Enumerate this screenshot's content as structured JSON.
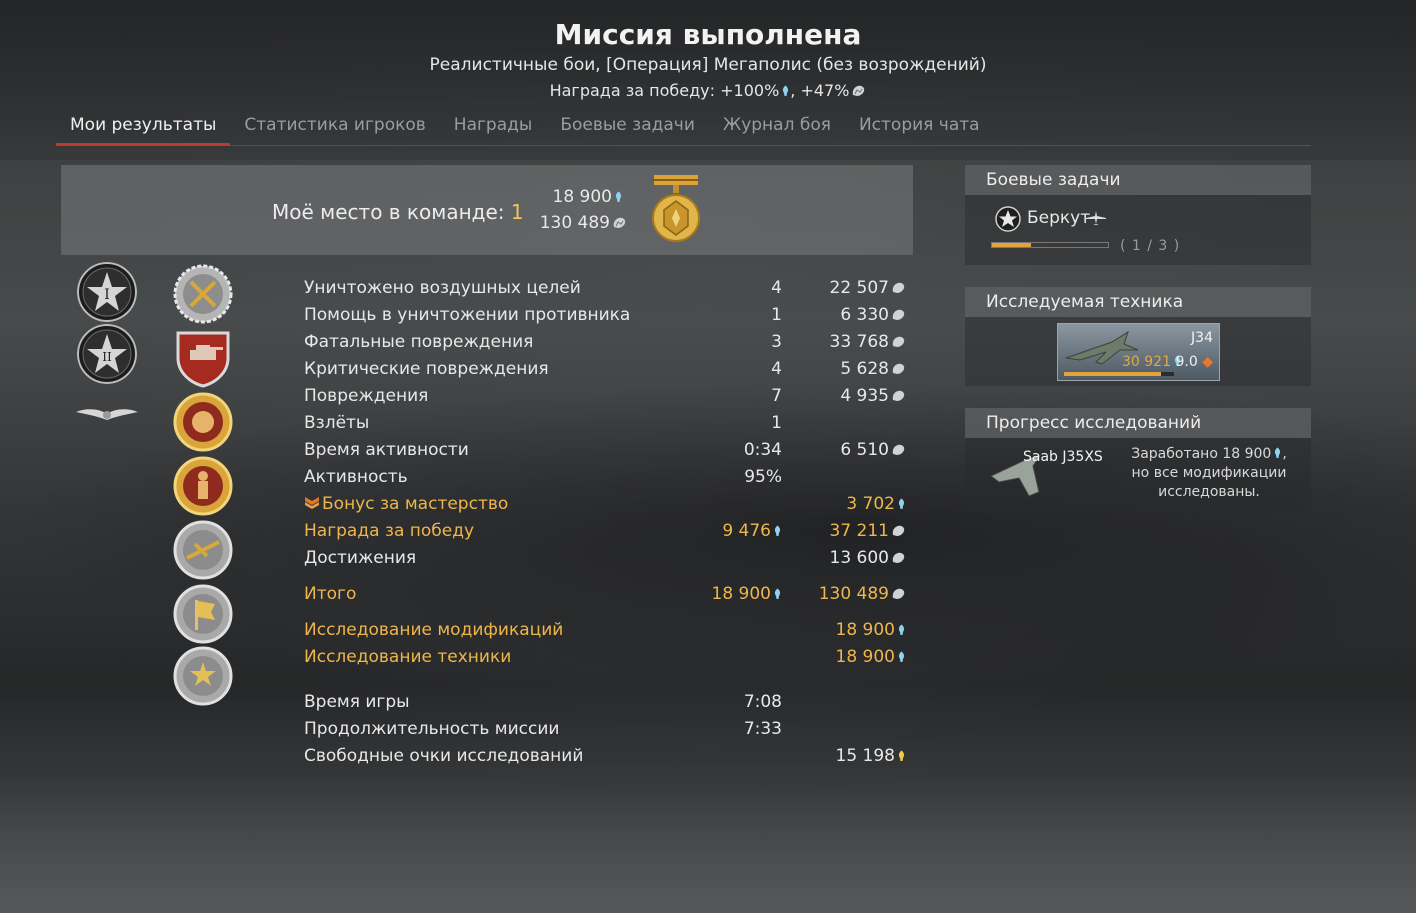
{
  "header": {
    "title": "Миссия выполнена",
    "subtitle": "Реалистичные бои, [Операция] Мегаполис (без возрождений)",
    "reward_prefix": "Награда за победу: +100%",
    "reward_sep": ", +47%"
  },
  "tabs": [
    {
      "label": "Мои результаты",
      "active": true
    },
    {
      "label": "Статистика игроков"
    },
    {
      "label": "Награды"
    },
    {
      "label": "Боевые задачи"
    },
    {
      "label": "Журнал боя"
    },
    {
      "label": "История чата"
    }
  ],
  "team_place": {
    "label": "Моё место в команде:",
    "place": "1",
    "rp": "18 900",
    "sl": "130 489"
  },
  "stats": [
    {
      "label": "Уничтожено воздушных целей",
      "count": "4",
      "value": "22 507",
      "icon": "sl"
    },
    {
      "label": "Помощь в уничтожении противника",
      "count": "1",
      "value": "6 330",
      "icon": "sl"
    },
    {
      "label": "Фатальные повреждения",
      "count": "3",
      "value": "33 768",
      "icon": "sl"
    },
    {
      "label": "Критические повреждения",
      "count": "4",
      "value": "5 628",
      "icon": "sl"
    },
    {
      "label": "Повреждения",
      "count": "7",
      "value": "4 935",
      "icon": "sl"
    },
    {
      "label": "Взлёты",
      "count": "1",
      "value": "",
      "icon": ""
    },
    {
      "label": "Время активности",
      "count": "0:34",
      "value": "6 510",
      "icon": "sl"
    },
    {
      "label": "Активность",
      "count": "95%",
      "value": "",
      "icon": ""
    },
    {
      "label": "Бонус за мастерство",
      "count": "",
      "value": "3 702",
      "icon": "rp"
    },
    {
      "label": "Награда за победу",
      "count": "9 476",
      "value": "37 211",
      "icon": "sl"
    },
    {
      "label": "Достижения",
      "count": "",
      "value": "13 600",
      "icon": "sl"
    },
    {
      "label": "Итого",
      "count": "18 900",
      "value": "130 489",
      "icon": "sl"
    },
    {
      "label": "Исследование модификаций",
      "count": "",
      "value": "18 900",
      "icon": "rp"
    },
    {
      "label": "Исследование техники",
      "count": "",
      "value": "18 900",
      "icon": "rp"
    },
    {
      "label": "Время игры",
      "count": "7:08",
      "value": "",
      "icon": ""
    },
    {
      "label": "Продолжительность миссии",
      "count": "7:33",
      "value": "",
      "icon": ""
    },
    {
      "label": "Свободные очки исследований",
      "count": "",
      "value": "15 198",
      "icon": "frp"
    }
  ],
  "battle_tasks": {
    "heading": "Боевые задачи",
    "task_name": "Беркут",
    "progress_text": "( 1 / 3 )",
    "progress": 0.333
  },
  "research_vehicle": {
    "heading": "Исследуемая техника",
    "name": "J34",
    "rp": "30 921",
    "br": "9.0",
    "progress": 0.88
  },
  "research_progress": {
    "heading": "Прогресс исследований",
    "vehicle": "Saab J35XS",
    "line1": "Заработано 18 900",
    "line2": "но все модификации",
    "line3": "исследованы."
  },
  "colors": {
    "gold": "#efb64a",
    "tab_accent": "#c0392b",
    "rp_blue": "#8fd2f0"
  }
}
